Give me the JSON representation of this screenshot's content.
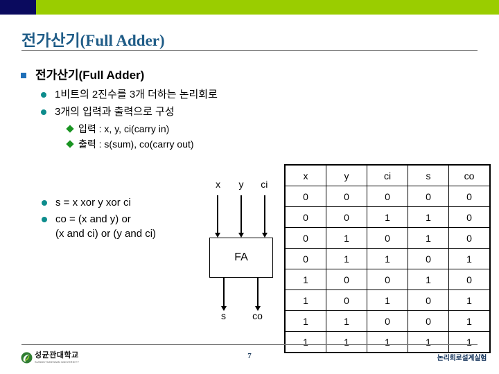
{
  "slide": {
    "title": "전가산기(Full Adder)",
    "page_number": "7",
    "footer_right_label": "논리회로설계실험",
    "logo": {
      "korean_name": "성균관대학교",
      "english_name": "SUNGKYUNKWAN UNIVERSITY"
    },
    "colors": {
      "banner_navy": "#0a0a5e",
      "banner_green": "#9acd00",
      "title_blue": "#1f5c87",
      "bullet_square_blue": "#1f6fb8",
      "bullet_circle_teal": "#0d8c8c",
      "bullet_diamond_green": "#1a9422",
      "footer_navy": "#17365d"
    }
  },
  "outline": {
    "heading": "전가산기(Full Adder)",
    "level2": [
      "1비트의 2진수를 3개 더하는 논리회로",
      "3개의 입력과 출력으로 구성"
    ],
    "level3": [
      "입력 : x, y, ci(carry in)",
      "출력 : s(sum), co(carry out)"
    ]
  },
  "equations": [
    "s = x xor y xor ci",
    "co = (x and y) or",
    "(x and ci) or (y and ci)"
  ],
  "diagram": {
    "block_label": "FA",
    "inputs": [
      "x",
      "y",
      "ci"
    ],
    "outputs": [
      "s",
      "co"
    ]
  },
  "chart_data": {
    "type": "table",
    "title": "Full Adder truth table",
    "columns": [
      "x",
      "y",
      "ci",
      "s",
      "co"
    ],
    "rows": [
      [
        "0",
        "0",
        "0",
        "0",
        "0"
      ],
      [
        "0",
        "0",
        "1",
        "1",
        "0"
      ],
      [
        "0",
        "1",
        "0",
        "1",
        "0"
      ],
      [
        "0",
        "1",
        "1",
        "0",
        "1"
      ],
      [
        "1",
        "0",
        "0",
        "1",
        "0"
      ],
      [
        "1",
        "0",
        "1",
        "0",
        "1"
      ],
      [
        "1",
        "1",
        "0",
        "0",
        "1"
      ],
      [
        "1",
        "1",
        "1",
        "1",
        "1"
      ]
    ]
  }
}
